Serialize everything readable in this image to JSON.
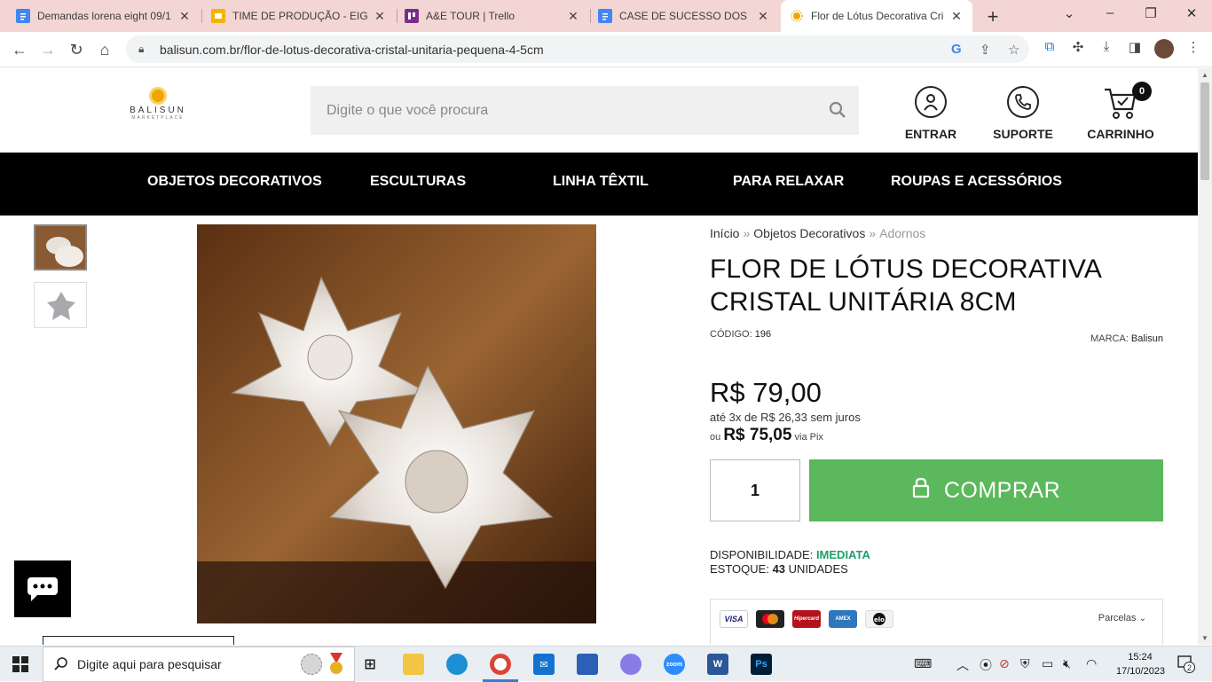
{
  "browser": {
    "tabs": [
      {
        "title": "Demandas lorena eight 09/1",
        "icon": "google-docs-icon",
        "color": "#4285f4",
        "active": false
      },
      {
        "title": "TIME DE PRODUÇÃO - EIGH",
        "icon": "google-slides-icon",
        "color": "#f4b400",
        "active": false
      },
      {
        "title": "A&E TOUR | Trello",
        "icon": "trello-icon",
        "color": "#7b2d8e",
        "active": false
      },
      {
        "title": "CASE DE SUCESSO DOS CLI",
        "icon": "google-docs-icon",
        "color": "#4285f4",
        "active": false
      },
      {
        "title": "Flor de Lótus Decorativa Cri",
        "icon": "balisun-favicon",
        "color": "#f0a500",
        "active": true
      }
    ],
    "url": "balisun.com.br/flor-de-lotus-decorativa-cristal-unitaria-pequena-4-5cm"
  },
  "site": {
    "logo": {
      "name": "BALISUN",
      "tagline": "MARKETPLACE"
    },
    "search_placeholder": "Digite o que você procura",
    "header_buttons": {
      "login": "ENTRAR",
      "support": "SUPORTE",
      "cart": "CARRINHO",
      "cart_count": "0"
    },
    "menu": [
      "OBJETOS DECORATIVOS",
      "ESCULTURAS",
      "LINHA TÊXTIL",
      "PARA RELAXAR",
      "ROUPAS E ACESSÓRIOS"
    ]
  },
  "product": {
    "breadcrumb": [
      "Início",
      "Objetos Decorativos",
      "Adornos"
    ],
    "breadcrumb_sep": "»",
    "title": "FLOR DE LÓTUS DECORATIVA CRISTAL UNITÁRIA 8CM",
    "code_label": "CÓDIGO:",
    "code": "196",
    "brand_label": "MARCA:",
    "brand": "Balisun",
    "price": "R$ 79,00",
    "installments": "até 3x de R$ 26,33 sem juros",
    "pix_prefix": "ou",
    "pix_price": "R$ 75,05",
    "pix_suffix": "via Pix",
    "quantity": "1",
    "buy_label": "COMPRAR",
    "availability_label": "DISPONIBILIDADE:",
    "availability": "IMEDIATA",
    "stock_label": "ESTOQUE:",
    "stock_value": "43",
    "stock_unit": "UNIDADES",
    "payment_cards": [
      "VISA",
      "mastercard",
      "Hipercard",
      "AMEX",
      "elo"
    ],
    "installments_toggle": "Parcelas"
  },
  "taskbar": {
    "search_placeholder": "Digite aqui para pesquisar",
    "time": "15:24",
    "date": "17/10/2023",
    "notifications": "2"
  }
}
